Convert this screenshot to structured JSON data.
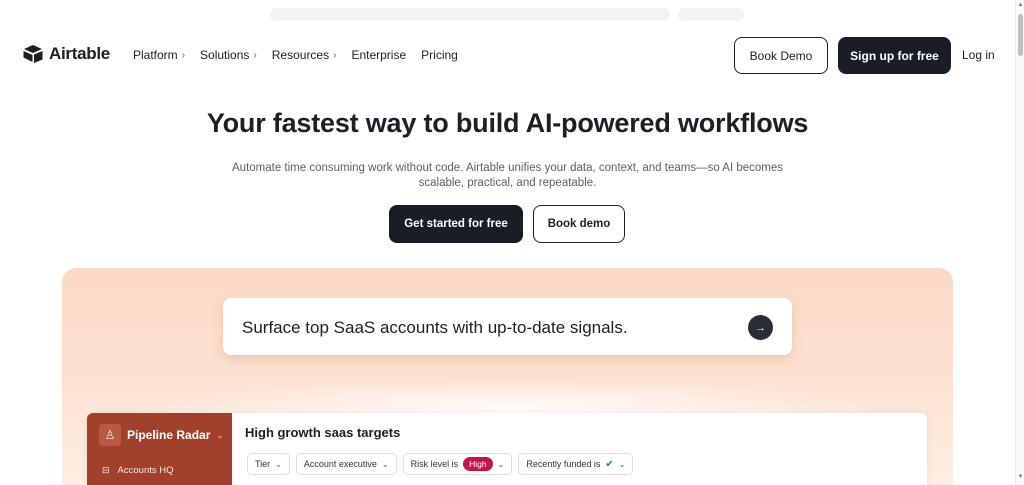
{
  "nav": {
    "logo_text": "Airtable",
    "links": [
      {
        "label": "Platform",
        "has_chevron": true
      },
      {
        "label": "Solutions",
        "has_chevron": true
      },
      {
        "label": "Resources",
        "has_chevron": true
      },
      {
        "label": "Enterprise",
        "has_chevron": false
      },
      {
        "label": "Pricing",
        "has_chevron": false
      }
    ],
    "book_demo": "Book Demo",
    "signup": "Sign up for free",
    "login": "Log in"
  },
  "hero": {
    "title": "Your fastest way to build AI-powered workflows",
    "subtitle": "Automate time consuming work without code. Airtable unifies your data, context, and teams—so AI becomes scalable, practical, and repeatable.",
    "cta_primary": "Get started for free",
    "cta_secondary": "Book demo"
  },
  "prompt": {
    "text": "Surface top SaaS accounts with up-to-date signals.",
    "arrow_icon": "arrow-right-icon"
  },
  "app_preview": {
    "sidebar_title": "Pipeline Radar",
    "sidebar_items": [
      "Accounts HQ"
    ],
    "view_title": "High growth saas targets",
    "filters": {
      "tier": "Tier",
      "account_exec": "Account executive",
      "risk_prefix": "Risk level is",
      "risk_value": "High",
      "funded_prefix": "Recently funded is"
    }
  },
  "colors": {
    "dark_button": "#181d26",
    "peach": "#fcd9c6",
    "sidebar": "#a1412c",
    "high_badge": "#c2154a"
  }
}
